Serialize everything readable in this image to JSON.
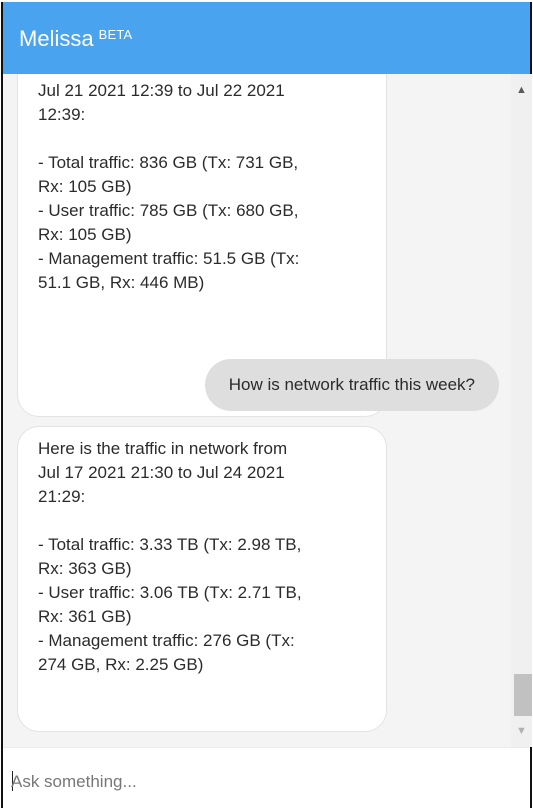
{
  "header": {
    "title": "Melissa",
    "badge": "BETA",
    "background_color": "#4aa3ef"
  },
  "messages": [
    {
      "sender": "bot",
      "lines": [
        "Jul 21 2021 12:39 to Jul 22 2021",
        "12:39:",
        "",
        "- Total traffic: 836 GB (Tx: 731 GB,",
        "Rx: 105 GB)",
        "- User traffic: 785 GB (Tx: 680 GB,",
        "Rx: 105 GB)",
        "- Management traffic: 51.5 GB (Tx:",
        "51.1 GB, Rx: 446 MB)"
      ]
    },
    {
      "sender": "user",
      "text": "How is network traffic this week?"
    },
    {
      "sender": "bot",
      "lines": [
        "Here is the traffic in network from",
        "Jul 17 2021 21:30 to Jul 24 2021",
        "21:29:",
        "",
        "- Total traffic: 3.33 TB (Tx: 2.98 TB,",
        "Rx: 363 GB)",
        "- User traffic: 3.06 TB (Tx: 2.71 TB,",
        "Rx: 361 GB)",
        "- Management traffic: 276 GB (Tx:",
        "274 GB, Rx: 2.25 GB)"
      ]
    }
  ],
  "scrollbar": {
    "up_icon": "triangle-up-icon",
    "down_icon": "triangle-down-icon",
    "position": "bottom"
  },
  "input": {
    "placeholder": "Ask something...",
    "value": ""
  }
}
